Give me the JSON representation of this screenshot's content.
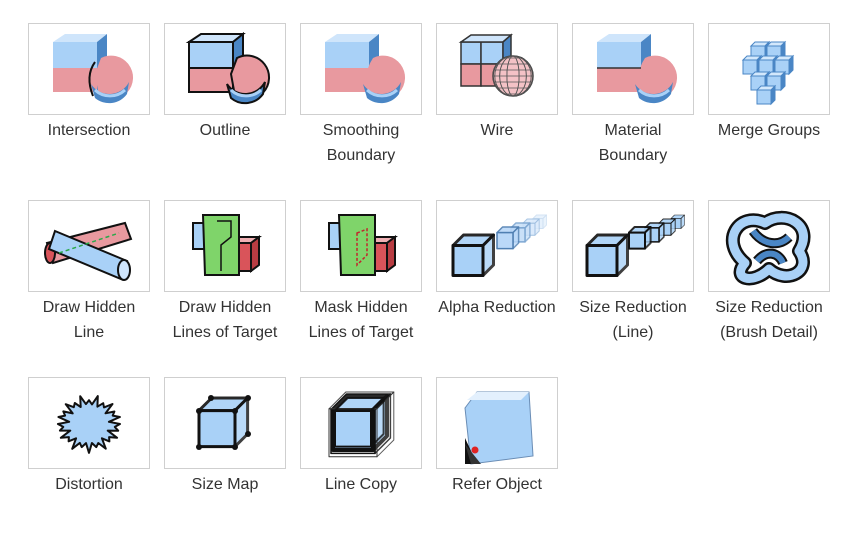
{
  "items": [
    {
      "id": "intersection",
      "label": "Intersection",
      "icon": "intersection-icon"
    },
    {
      "id": "outline",
      "label": "Outline",
      "icon": "outline-icon"
    },
    {
      "id": "smoothing-boundary",
      "label": "Smoothing\nBoundary",
      "icon": "smoothing-boundary-icon"
    },
    {
      "id": "wire",
      "label": "Wire",
      "icon": "wire-icon"
    },
    {
      "id": "material-boundary",
      "label": "Material\nBoundary",
      "icon": "material-boundary-icon"
    },
    {
      "id": "merge-groups",
      "label": "Merge Groups",
      "icon": "merge-groups-icon"
    },
    {
      "id": "draw-hidden-line",
      "label": "Draw Hidden\nLine",
      "icon": "draw-hidden-line-icon"
    },
    {
      "id": "draw-hidden-lines-of-target",
      "label": "Draw Hidden\nLines of Target",
      "icon": "draw-hidden-lines-of-target-icon"
    },
    {
      "id": "mask-hidden-lines-of-target",
      "label": "Mask Hidden\nLines of Target",
      "icon": "mask-hidden-lines-of-target-icon"
    },
    {
      "id": "alpha-reduction",
      "label": "Alpha Reduction",
      "icon": "alpha-reduction-icon"
    },
    {
      "id": "size-reduction-line",
      "label": "Size Reduction\n(Line)",
      "icon": "size-reduction-line-icon"
    },
    {
      "id": "size-reduction-brush-detail",
      "label": "Size Reduction\n(Brush Detail)",
      "icon": "size-reduction-brush-detail-icon"
    },
    {
      "id": "distortion",
      "label": "Distortion",
      "icon": "distortion-icon"
    },
    {
      "id": "size-map",
      "label": "Size Map",
      "icon": "size-map-icon"
    },
    {
      "id": "line-copy",
      "label": "Line Copy",
      "icon": "line-copy-icon"
    },
    {
      "id": "refer-object",
      "label": "Refer Object",
      "icon": "refer-object-icon"
    }
  ],
  "colors": {
    "light_blue": "#a9d1f7",
    "blue": "#4a86c5",
    "pink": "#e8999f",
    "red": "#d9545a",
    "green": "#7fd46a",
    "border": "#cfcfcf",
    "label": "#333333"
  }
}
